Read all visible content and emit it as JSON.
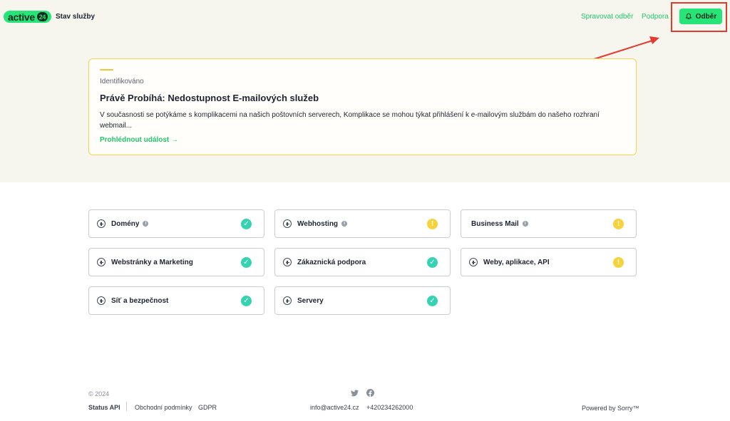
{
  "header": {
    "logo_text": "active",
    "logo_badge": "24",
    "page_title": "Stav služby",
    "nav_manage": "Spravovat odběr",
    "nav_support": "Podpora",
    "subscribe_label": "Odběr"
  },
  "incident": {
    "status": "Identifikováno",
    "title": "Právě Probíhá: Nedostupnost E-mailových služeb",
    "body": "V současnosti se potýkáme s komplikacemi na našich poštovních serverech, Komplikace se mohou týkat přihlášení k e-mailovým službám do našeho rozhraní webmail...",
    "link": "Prohlédnout událost →"
  },
  "services": [
    {
      "label": "Domény",
      "info": true,
      "status": "ok"
    },
    {
      "label": "Webhosting",
      "info": true,
      "status": "warn"
    },
    {
      "label": "Business Mail",
      "info": true,
      "status": "warn"
    },
    {
      "label": "Webstránky a Marketing",
      "info": false,
      "status": "ok"
    },
    {
      "label": "Zákaznická podpora",
      "info": false,
      "status": "ok"
    },
    {
      "label": "Weby, aplikace, API",
      "info": false,
      "status": "warn"
    },
    {
      "label": "Síť a bezpečnost",
      "info": false,
      "status": "ok"
    },
    {
      "label": "Servery",
      "info": false,
      "status": "ok"
    }
  ],
  "footer": {
    "copyright": "© 2024",
    "status_api": "Status API",
    "terms": "Obchodní podmínky",
    "gdpr": "GDPR",
    "email": "info@active24.cz",
    "phone": "+420234262000",
    "powered": "Powered by Sorry™"
  },
  "colors": {
    "brand_green": "#27e479",
    "link_green": "#22c76a",
    "status_ok": "#36d3b3",
    "status_warn": "#f7d23a",
    "annotation_red": "#e53a2f"
  },
  "icons": {
    "subscribe": "bell-icon",
    "expand": "plus-circle-icon",
    "info": "info-icon",
    "ok": "check-circle-icon",
    "warn": "exclamation-circle-icon",
    "twitter": "twitter-icon",
    "facebook": "facebook-icon"
  }
}
